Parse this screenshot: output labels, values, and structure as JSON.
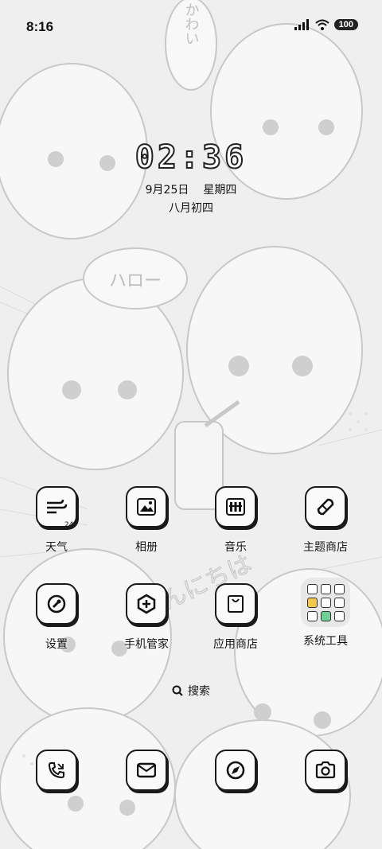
{
  "status_bar": {
    "time": "8:16",
    "battery": "100"
  },
  "lockscreen": {
    "clock": "02:36",
    "date": "9月25日",
    "weekday": "星期四",
    "lunar": "八月初四"
  },
  "wallpaper_text": {
    "bubble_top": "かわい",
    "bubble_mid": "ハロー",
    "diagonal": "こんにちは"
  },
  "apps_row1": [
    {
      "label": "天气",
      "icon": "weather-wind-icon",
      "badge": "24°"
    },
    {
      "label": "相册",
      "icon": "gallery-icon"
    },
    {
      "label": "音乐",
      "icon": "music-icon"
    },
    {
      "label": "主题商店",
      "icon": "theme-store-icon"
    }
  ],
  "apps_row2": [
    {
      "label": "设置",
      "icon": "settings-icon"
    },
    {
      "label": "手机管家",
      "icon": "security-icon"
    },
    {
      "label": "应用商店",
      "icon": "app-store-icon"
    },
    {
      "label": "系统工具",
      "icon": "folder-icon"
    }
  ],
  "search": {
    "label": "搜索",
    "icon": "search-icon"
  },
  "dock": [
    {
      "icon": "phone-icon"
    },
    {
      "icon": "messages-icon"
    },
    {
      "icon": "browser-icon"
    },
    {
      "icon": "camera-icon"
    }
  ]
}
